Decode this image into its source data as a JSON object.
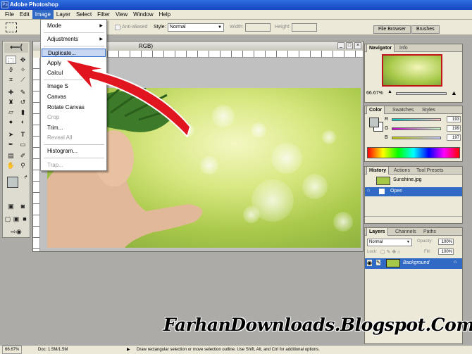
{
  "window": {
    "title": "Adobe Photoshop"
  },
  "menubar": [
    "File",
    "Edit",
    "Image",
    "Layer",
    "Select",
    "Filter",
    "View",
    "Window",
    "Help"
  ],
  "image_menu": {
    "items": [
      {
        "label": "Mode",
        "submenu": true
      },
      {
        "label": "Adjustments",
        "submenu": true
      },
      {
        "label": "Duplicate...",
        "highlighted": true
      },
      {
        "label": "Apply"
      },
      {
        "label": "Calcul"
      },
      {
        "label": "Image S"
      },
      {
        "label": "Canvas"
      },
      {
        "label": "Rotate Canvas"
      },
      {
        "label": "Crop",
        "disabled": true
      },
      {
        "label": "Trim..."
      },
      {
        "label": "Reveal All",
        "disabled": true
      },
      {
        "label": "Histogram..."
      },
      {
        "label": "Trap...",
        "disabled": true
      }
    ]
  },
  "options_bar": {
    "anti_aliased": "Anti-aliased",
    "style_label": "Style:",
    "style_value": "Normal",
    "width_label": "Width:",
    "height_label": "Height:",
    "well_tabs": [
      "File Browser",
      "Brushes"
    ]
  },
  "document": {
    "title_suffix": "RGB)"
  },
  "navigator": {
    "tabs": [
      "Navigator",
      "Info"
    ],
    "zoom": "66.67%"
  },
  "color_panel": {
    "tabs": [
      "Color",
      "Swatches",
      "Styles"
    ],
    "channels": [
      {
        "label": "R",
        "value": "193"
      },
      {
        "label": "G",
        "value": "199"
      },
      {
        "label": "B",
        "value": "197"
      }
    ]
  },
  "history_panel": {
    "tabs": [
      "History",
      "Actions",
      "Tool Presets"
    ],
    "snapshot": "Sunshine.jpg",
    "states": [
      "Open"
    ]
  },
  "layers_panel": {
    "tabs": [
      "Layers",
      "Channels",
      "Paths"
    ],
    "blend_mode": "Normal",
    "opacity_label": "Opacity:",
    "opacity": "100%",
    "lock_label": "Lock:",
    "fill_label": "Fill:",
    "fill": "100%",
    "layers": [
      "Background"
    ]
  },
  "status_bar": {
    "zoom": "66.67%",
    "doc": "Doc: 1.5M/1.5M",
    "hint": "Draw rectangular selection or move selection outline.  Use Shift, Alt, and Ctrl for additional options."
  },
  "watermark": "FarhanDownloads.Blogspot.Com",
  "colors": {
    "accent": "#316ac5",
    "arrow": "#e0151f",
    "foreground_swatch": "#c1c7c5"
  }
}
